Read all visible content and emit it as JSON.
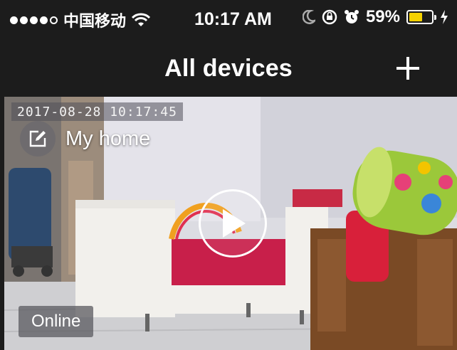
{
  "status_bar": {
    "signal_bars_filled": 4,
    "signal_bars_total": 5,
    "carrier": "中国移动",
    "time": "10:17 AM",
    "battery_percent": "59%",
    "battery_level": 0.59,
    "icons": [
      "wifi-icon",
      "moon-icon",
      "rotation-lock-icon",
      "alarm-icon",
      "battery-icon",
      "charging-bolt-icon"
    ],
    "battery_color": "#f5d200"
  },
  "nav": {
    "title": "All devices",
    "add_icon": "plus-icon"
  },
  "camera": {
    "timestamp": "2017-08-28   10:17:45",
    "device_name": "My home",
    "edit_icon": "edit-icon",
    "play_icon": "play-icon",
    "status": "Online"
  },
  "colors": {
    "background": "#1c1c1c",
    "text": "#ffffff"
  }
}
